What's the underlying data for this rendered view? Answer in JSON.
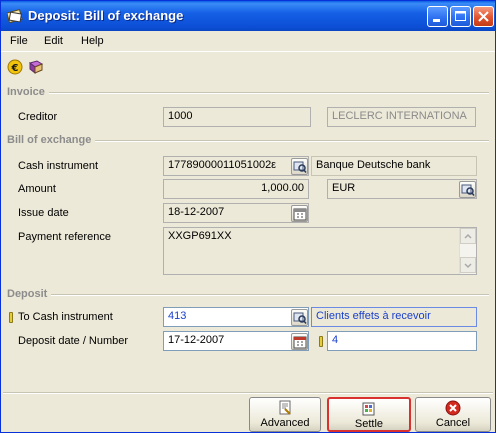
{
  "window": {
    "title": "Deposit: Bill of exchange",
    "app_icon": "deposit-slip-icon"
  },
  "menu": [
    "File",
    "Edit",
    "Help"
  ],
  "toolbar": {
    "icons": [
      "euro-coin-icon",
      "book-icon"
    ]
  },
  "sections": {
    "invoice": "Invoice",
    "bill": "Bill of exchange",
    "deposit": "Deposit"
  },
  "invoice": {
    "creditor_label": "Creditor",
    "creditor_code": "1000",
    "creditor_name": "LECLERC INTERNATIONA"
  },
  "bill": {
    "cash_instrument_label": "Cash instrument",
    "cash_instrument_value": "17789000011051002ε",
    "bank_name": "Banque Deutsche bank",
    "amount_label": "Amount",
    "amount_value": "1,000.00",
    "currency": "EUR",
    "issue_date_label": "Issue date",
    "issue_date_value": "18-12-2007",
    "payment_ref_label": "Payment reference",
    "payment_ref_value": "XXGP691XX"
  },
  "deposit": {
    "to_cash_label": "To Cash instrument",
    "to_cash_value": "413",
    "to_cash_name": "Clients effets à recevoir",
    "date_number_label": "Deposit date / Number",
    "deposit_date": "17-12-2007",
    "deposit_number": "4"
  },
  "buttons": {
    "advanced": "Advanced",
    "settle": "Settle",
    "cancel": "Cancel"
  },
  "colors": {
    "titlebar": "#0c4fd6",
    "link_blue": "#1a3fcc",
    "focus_red": "#d93030"
  }
}
